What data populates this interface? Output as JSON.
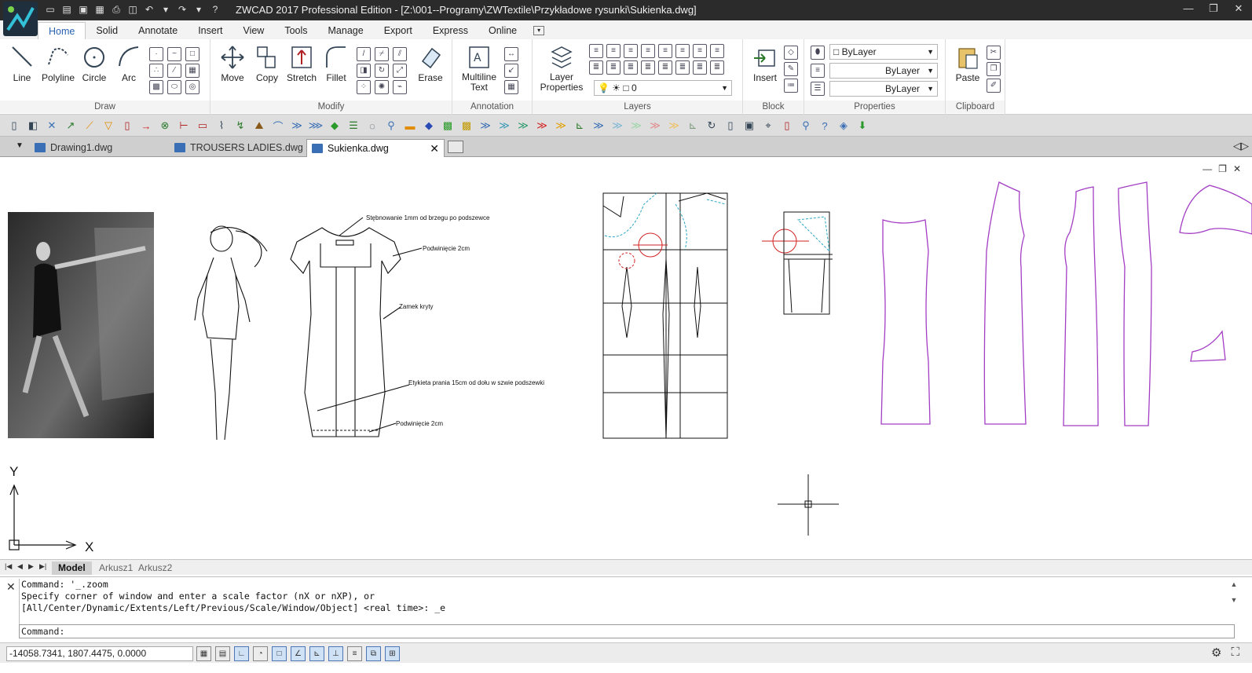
{
  "window": {
    "title": "ZWCAD 2017 Professional Edition - [Z:\\001--Programy\\ZWTextile\\Przykładowe rysunki\\Sukienka.dwg]",
    "controls": [
      "minimize-icon",
      "restore-icon",
      "close-icon"
    ]
  },
  "ribbon": {
    "tabs": [
      "Home",
      "Solid",
      "Annotate",
      "Insert",
      "View",
      "Tools",
      "Manage",
      "Export",
      "Express",
      "Online"
    ],
    "active_tab": "Home",
    "panels": {
      "draw": {
        "title": "Draw",
        "buttons": [
          "Line",
          "Polyline",
          "Circle",
          "Arc"
        ]
      },
      "modify": {
        "title": "Modify",
        "buttons": [
          "Move",
          "Copy",
          "Stretch",
          "Fillet",
          "Erase"
        ]
      },
      "annotation": {
        "title": "Annotation",
        "buttons": [
          "Multiline",
          "Text"
        ]
      },
      "layers": {
        "title": "Layers",
        "button_line1": "Layer",
        "button_line2": "Properties",
        "current_layer": "0"
      },
      "block": {
        "title": "Block",
        "buttons": [
          "Insert"
        ]
      },
      "properties": {
        "title": "Properties",
        "color": "ByLayer",
        "linetype": "ByLayer",
        "lineweight": "ByLayer"
      },
      "clipboard": {
        "title": "Clipboard",
        "buttons": [
          "Paste"
        ]
      }
    }
  },
  "doc_tabs": [
    {
      "label": "Drawing1.dwg"
    },
    {
      "label": "TROUSERS LADIES.dwg"
    },
    {
      "label": "Sukienka.dwg",
      "active": true
    }
  ],
  "drawing": {
    "annotations": [
      "Stębnowanie 1mm od brzegu po podszewce",
      "Podwinięcie 2cm",
      "Zamek kryty",
      "Etykieta prania 15cm od dołu w szwie podszewki",
      "Podwinięcie 2cm"
    ],
    "ucs": {
      "x": "X",
      "y": "Y"
    }
  },
  "layout_tabs": [
    "Model",
    "Arkusz1",
    "Arkusz2"
  ],
  "command": {
    "history": [
      "Command: '_.zoom",
      "Specify corner of window and enter a scale factor (nX or nXP), or",
      "[All/Center/Dynamic/Extents/Left/Previous/Scale/Window/Object] <real time>: _e"
    ],
    "prompt": "Command:"
  },
  "status": {
    "coordinates": "-14058.7341, 1807.4475, 0.0000"
  },
  "colors": {
    "titlebar": "#2b2b2b",
    "accent_tab": "#2a62b0",
    "pattern_purple": "#a33dc4",
    "crosshair_red": "#d12222",
    "construction_cyan": "#2aa6c4"
  }
}
